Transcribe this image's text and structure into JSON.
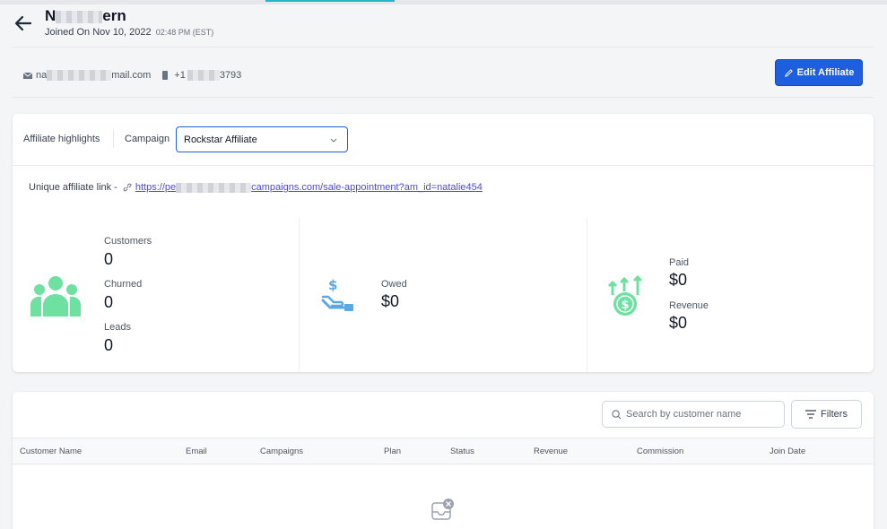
{
  "header": {
    "name_prefix": "N",
    "name_suffix": "ern",
    "joined": "Joined On Nov 10, 2022",
    "joined_time": "02:48 PM (EST)"
  },
  "contact": {
    "email_prefix": "na",
    "email_suffix": "mail.com",
    "phone_prefix": "+1",
    "phone_suffix": "3793"
  },
  "actions": {
    "edit_label": "Edit Affiliate"
  },
  "highlights": {
    "label": "Affiliate highlights",
    "campaign_label": "Campaign",
    "campaign_value": "Rockstar Affiliate"
  },
  "link": {
    "label": "Unique affiliate link -",
    "url_prefix": "https://pe",
    "url_suffix": "campaigns.com/sale-appointment?am_id=natalie454"
  },
  "stats": {
    "customers_label": "Customers",
    "customers_value": "0",
    "churned_label": "Churned",
    "churned_value": "0",
    "leads_label": "Leads",
    "leads_value": "0",
    "owed_label": "Owed",
    "owed_value": "$0",
    "paid_label": "Paid",
    "paid_value": "$0",
    "revenue_label": "Revenue",
    "revenue_value": "$0"
  },
  "table": {
    "search_placeholder": "Search by customer name",
    "filters_label": "Filters",
    "columns": [
      "Customer Name",
      "Email",
      "Campaigns",
      "Plan",
      "Status",
      "Revenue",
      "Commission",
      "Join Date"
    ]
  },
  "colors": {
    "primary": "#1d5fe0",
    "green": "#6ee0a0",
    "blue_icon": "#5aa9e6",
    "link": "#4f46e5"
  }
}
